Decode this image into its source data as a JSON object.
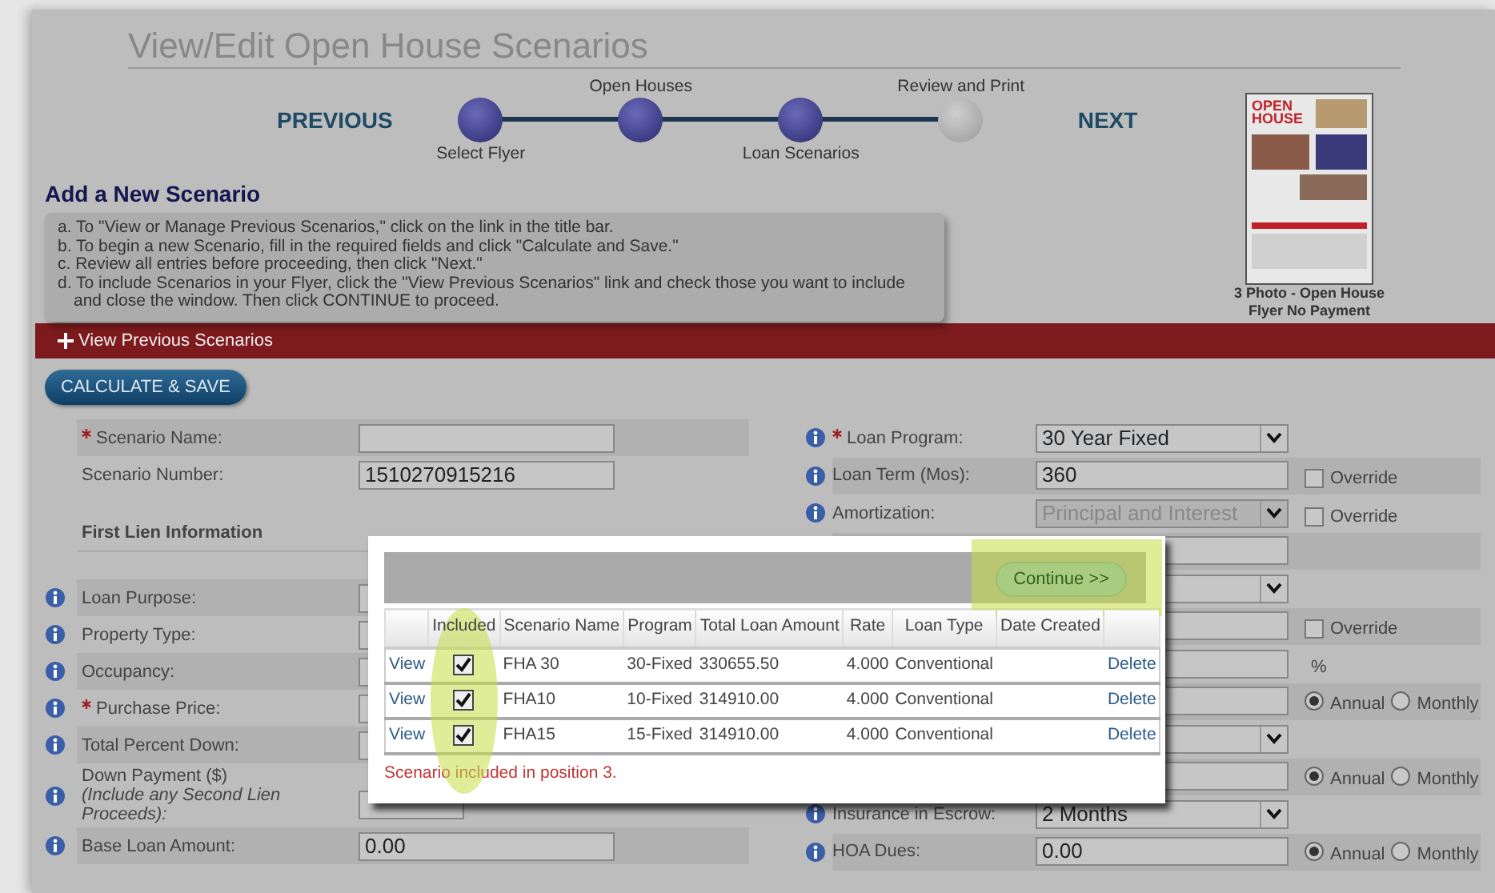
{
  "page": {
    "title": "View/Edit Open House Scenarios"
  },
  "stepper": {
    "previous": "PREVIOUS",
    "next": "NEXT",
    "steps": [
      {
        "label": "Select Flyer",
        "done": true
      },
      {
        "label": "Open Houses",
        "done": true
      },
      {
        "label": "Loan Scenarios",
        "done": true
      },
      {
        "label": "Review and Print",
        "done": false
      }
    ]
  },
  "flyer": {
    "heading": "OPEN HOUSE",
    "caption": "3 Photo - Open House Flyer No Payment"
  },
  "section": {
    "title": "Add a New Scenario",
    "instructions": [
      "a. To \"View or Manage Previous Scenarios,\" click on the link in the title bar.",
      "b. To begin a new Scenario, fill in the required fields and click \"Calculate and Save.\"",
      "c. Review all entries before proceeding, then click \"Next.\"",
      "d. To include Scenarios in your Flyer, click the \"View Previous Scenarios\" link and check those you want to include and close the window. Then click CONTINUE to proceed."
    ]
  },
  "previous_bar": {
    "label": "View Previous Scenarios",
    "expanded": false
  },
  "calculate_button": "CALCULATE & SAVE",
  "left_fields": [
    {
      "kind": "field",
      "label": "Scenario Name:",
      "required": true,
      "info": false
    },
    {
      "kind": "field",
      "label": "Scenario Number:",
      "required": false,
      "info": false,
      "value": "1510270915216"
    },
    {
      "kind": "heading",
      "label": "First Lien Information"
    },
    {
      "kind": "field",
      "label": "Loan Purpose:",
      "required": false,
      "info": true
    },
    {
      "kind": "field",
      "label": "Property Type:",
      "required": false,
      "info": true
    },
    {
      "kind": "field",
      "label": "Occupancy:",
      "required": false,
      "info": true
    },
    {
      "kind": "field",
      "label": "Purchase Price:",
      "required": true,
      "info": true
    },
    {
      "kind": "field",
      "label": "Total Percent Down:",
      "required": false,
      "info": true
    },
    {
      "kind": "field",
      "label": "Down Payment ($)",
      "note": "(Include any Second Lien Proceeds):",
      "required": false,
      "info": true,
      "narrow": true
    },
    {
      "kind": "field",
      "label": "Base Loan Amount:",
      "required": false,
      "info": true,
      "value": "0.00"
    }
  ],
  "right_fields": [
    {
      "kind": "select",
      "label": "Loan Program:",
      "required": true,
      "info": true,
      "disabled": false,
      "value": "30 Year Fixed"
    },
    {
      "kind": "input",
      "label": "Loan Term (Mos):",
      "required": false,
      "info": true,
      "disabled": false,
      "value": "360",
      "override": {
        "label": "Override",
        "checked": false
      }
    },
    {
      "kind": "select",
      "label": "Amortization:",
      "required": false,
      "info": true,
      "disabled": true,
      "value": "Principal and Interest",
      "override": {
        "label": "Override",
        "checked": false
      }
    },
    {
      "kind": "input",
      "disabled": false
    },
    {
      "kind": "select",
      "disabled": false
    },
    {
      "kind": "input",
      "disabled": false,
      "override": {
        "label": "Override",
        "checked": false
      }
    },
    {
      "kind": "input",
      "disabled": false,
      "unit": "%"
    },
    {
      "kind": "input",
      "disabled": false,
      "options": [
        {
          "label": "Annual",
          "selected": true
        },
        {
          "label": "Monthly",
          "selected": false
        }
      ]
    },
    {
      "kind": "select",
      "disabled": false
    },
    {
      "kind": "input",
      "disabled": false,
      "options": [
        {
          "label": "Annual",
          "selected": true
        },
        {
          "label": "Monthly",
          "selected": false
        }
      ]
    },
    {
      "kind": "select",
      "label": "Insurance in Escrow:",
      "required": false,
      "info": true,
      "disabled": false,
      "value": "2 Months"
    },
    {
      "kind": "input",
      "label": "HOA Dues:",
      "required": false,
      "info": true,
      "disabled": false,
      "value": "0.00",
      "options": [
        {
          "label": "Annual",
          "selected": true
        },
        {
          "label": "Monthly",
          "selected": false
        }
      ]
    }
  ],
  "popup": {
    "continue_button": {
      "label": "Continue >>",
      "highlighted": true
    },
    "columns": [
      {
        "highlighted": false
      },
      {
        "label": "Included",
        "highlighted": true
      },
      {
        "label": "Scenario Name",
        "highlighted": false
      },
      {
        "label": "Program",
        "highlighted": false
      },
      {
        "label": "Total Loan Amount",
        "highlighted": false
      },
      {
        "label": "Rate",
        "highlighted": false
      },
      {
        "label": "Loan Type",
        "highlighted": false
      },
      {
        "label": "Date Created",
        "highlighted": false
      },
      {
        "highlighted": false
      }
    ],
    "rows": [
      {
        "view": "View",
        "included": true,
        "name": "FHA 30",
        "program": "30-Fixed",
        "amount": "330655.50",
        "rate": "4.000",
        "loan_type": "Conventional",
        "delete": "Delete"
      },
      {
        "view": "View",
        "included": true,
        "name": "FHA10",
        "program": "10-Fixed",
        "amount": "314910.00",
        "rate": "4.000",
        "loan_type": "Conventional",
        "delete": "Delete"
      },
      {
        "view": "View",
        "included": true,
        "name": "FHA15",
        "program": "15-Fixed",
        "amount": "314910.00",
        "rate": "4.000",
        "loan_type": "Conventional",
        "delete": "Delete"
      }
    ],
    "message": "Scenario included in position 3."
  }
}
